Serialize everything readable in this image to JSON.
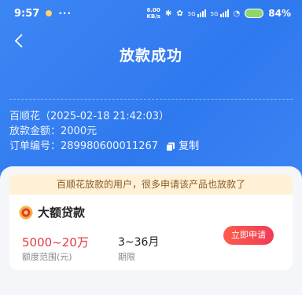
{
  "status_bar": {
    "time": "9:57",
    "more": "···",
    "net_speed_top": "6.00",
    "net_speed_bottom": "KB/s",
    "signal_label_1": "5G",
    "signal_label_2": "5G",
    "battery": "84%"
  },
  "header": {
    "title": "放款成功"
  },
  "loan_info": {
    "lender_line": "百顺花（2025-02-18 21:42:03）",
    "amount_line": "放款金额：2000元",
    "order_label": "订单编号：",
    "order_number": "289980600011267",
    "copy_label": "复制"
  },
  "recommend": {
    "notice": "百顺花放款的用户，很多申请该产品也放款了",
    "product_name": "大额贷款",
    "amount_range": "5000~20万",
    "amount_range_label": "额度范围(元)",
    "term": "3~36月",
    "term_label": "期限",
    "apply_label": "立即申请"
  },
  "colors": {
    "hero_blue": "#3380f2",
    "accent_red": "#e4393c",
    "notice_bg": "#fff0d6"
  }
}
